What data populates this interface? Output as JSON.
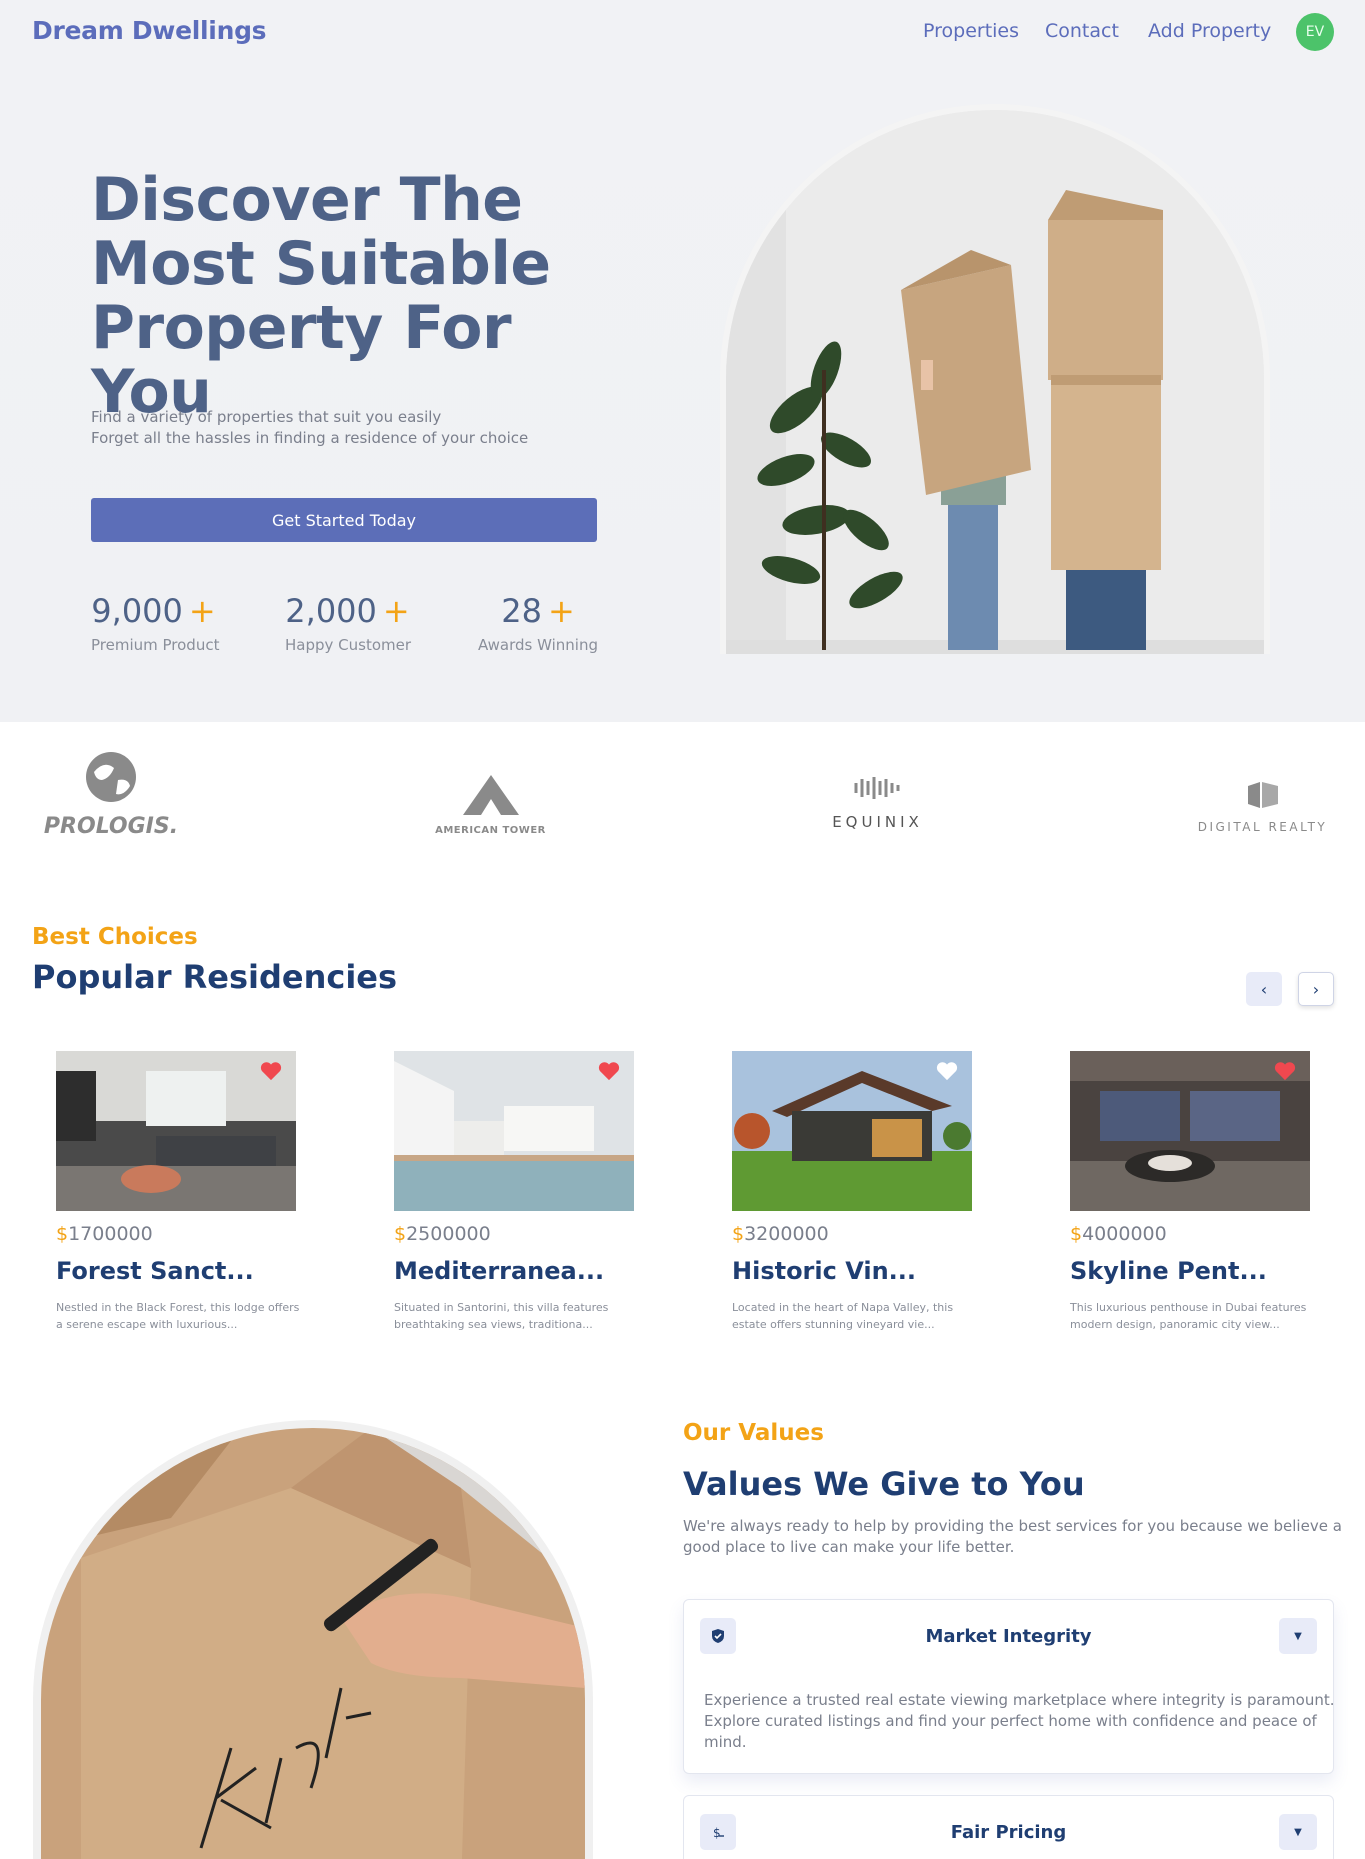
{
  "nav": {
    "brand": "Dream Dwellings",
    "links": [
      "Properties",
      "Contact",
      "Add Property"
    ],
    "avatar_initials": "EV"
  },
  "hero": {
    "title": "Discover The Most Suitable Property For You",
    "subtitle_lines": [
      "Find a variety of properties that suit you easily",
      "Forget all the hassles in finding a residence of your choice"
    ],
    "cta_label": "Get Started Today",
    "stats": [
      {
        "value": "9,000",
        "plus": "+",
        "label": "Premium Product"
      },
      {
        "value": "2,000",
        "plus": "+",
        "label": "Happy Customer"
      },
      {
        "value": "28",
        "plus": "+",
        "label": "Awards Winning"
      }
    ]
  },
  "partners": [
    {
      "name": "PROLOGIS.",
      "icon": "globe-icon"
    },
    {
      "name": "AMERICAN TOWER",
      "icon": "tower-icon"
    },
    {
      "name": "EQUINIX",
      "icon": "waveform-icon"
    },
    {
      "name": "DIGITAL REALTY",
      "icon": "cube-icon"
    }
  ],
  "residencies": {
    "eyebrow": "Best Choices",
    "title": "Popular Residencies",
    "prev_icon": "chevron-left-icon",
    "next_icon": "chevron-right-icon",
    "cards": [
      {
        "price_symbol": "$",
        "price": "1700000",
        "name": "Forest Sanct...",
        "desc_lines": [
          "Nestled in the Black Forest, this lodge offers",
          "a serene escape with luxurious..."
        ],
        "favorited": true
      },
      {
        "price_symbol": "$",
        "price": "2500000",
        "name": "Mediterranea...",
        "desc_lines": [
          "Situated in Santorini, this villa features",
          "breathtaking sea views, traditiona..."
        ],
        "favorited": true
      },
      {
        "price_symbol": "$",
        "price": "3200000",
        "name": "Historic Vin...",
        "desc_lines": [
          "Located in the heart of Napa Valley, this",
          "estate offers stunning vineyard vie..."
        ],
        "favorited": false
      },
      {
        "price_symbol": "$",
        "price": "4000000",
        "name": "Skyline Pent...",
        "desc_lines": [
          "This luxurious penthouse in Dubai features",
          "modern design, panoramic city view..."
        ],
        "favorited": true
      }
    ]
  },
  "values": {
    "eyebrow": "Our Values",
    "title": "Values We Give to You",
    "desc_lines": [
      "We're always ready to help by providing the best services for you because we believe a",
      "good place to live can make your life better."
    ],
    "items": [
      {
        "title": "Market Integrity",
        "icon": "shield-check-icon",
        "expanded": true,
        "body_lines": [
          "Experience a trusted real estate viewing marketplace where integrity is paramount.",
          "Explore curated listings and find your perfect home with confidence and peace of",
          "mind."
        ]
      },
      {
        "title": "Fair Pricing",
        "icon": "dollar-icon",
        "expanded": false
      }
    ]
  },
  "colors": {
    "brand": "#5c6dbb",
    "accent": "#f3a316",
    "heading": "#1f3e72",
    "heart_active": "#f0484f",
    "heart_inactive": "#ffffff",
    "avatar": "#4cc36a"
  }
}
